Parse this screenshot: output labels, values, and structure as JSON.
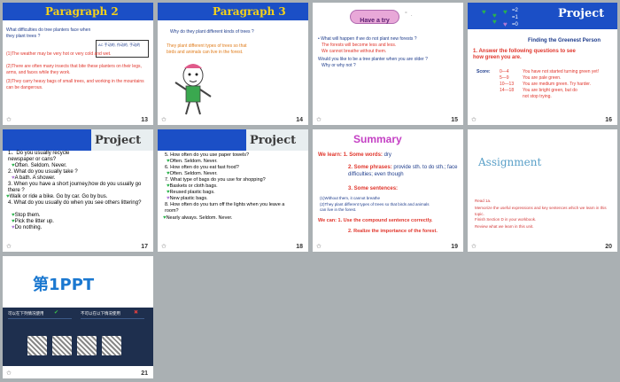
{
  "slides": [
    {
      "num": "13",
      "title": "Paragraph 2",
      "q": "What difficulties  do tree planters face when they plant trees ?",
      "note": "AC 手动的, 作动的, 手动的",
      "a": [
        "(1)The weather may be very hot or very cold and wet.",
        "(2)There are often many insects that bite these planters on their legs, arms, and faces while they work.",
        "(3)They carry heavy bags of small trees, and working in the mountains can be dangerous."
      ]
    },
    {
      "num": "14",
      "title": "Paragraph 3",
      "q": "Why do they plant different kinds of trees ?",
      "a": "They plant different types of trees so that birds and animals can live in the forest."
    },
    {
      "num": "15",
      "badge": "Have a try",
      "lines": [
        "What will happen if we do not plant new forests ?",
        "The forests will become less and less.",
        "We cannot breathe without them.",
        "Would you like to be a tree planter when you are older ?",
        "Why or why not ?"
      ]
    },
    {
      "num": "16",
      "title": "Project",
      "hearts": [
        "=2",
        "=1",
        "=0"
      ],
      "sub": "Finding the Greenest Person",
      "task": "1. Answer the following questions to see how green you are.",
      "score_label": "Score:",
      "scores": [
        [
          "0—4",
          "You have not started turning green yet!"
        ],
        [
          "5—9",
          "You are pale green."
        ],
        [
          "10—13",
          "You are medium green. Try harder."
        ],
        [
          "14—18",
          "You are bright green, but do not stop trying."
        ]
      ]
    },
    {
      "num": "17",
      "title": "Project",
      "lines": [
        "1、Do you usually recycle newspaper or cans?",
        "Often.    Seldom.    Never.",
        "2. What do you usually take ?",
        "A bath.         A shower.",
        "3. When you have a short journey,how do you usually go there ?",
        "Walk or ride a bike.   Go by car.   Go by bus.",
        "4. What do you usually do when you see others littering?",
        "Stop them.",
        "Pick the litter up.",
        "Do nothing."
      ]
    },
    {
      "num": "18",
      "title": "Project",
      "lines": [
        "5. How often do you use paper towels?",
        "Often.     Seldom.     Never.",
        "6. How often do you eat fast food?",
        "Often.     Seldom.     Never.",
        "7. What type of bags do you use for shopping?",
        "Baskets or cloth bags.",
        "Reused plastic bags.",
        "New plastic bags.",
        "8. How often do you turn off the lights when you leave a room?",
        "Nearly always.     Seldom.     Never."
      ]
    },
    {
      "num": "19",
      "title": "Summary",
      "l1": "We learn: 1. Some words:",
      "l1b": "dry",
      "l2": "2. Some phrases:",
      "l2b": "provide sth. to do sth.; face difficulties; even though",
      "l3": "3. Some sentences:",
      "s1": "(1)Without them, it cannot breathe",
      "s2": "(2)They plant different types of trees so that birds and animals can live in the forest.",
      "c1": "We can: 1. Use the compound sentence correctly.",
      "c2": "2. Realize the importance of the forest."
    },
    {
      "num": "20",
      "title": "Assignment",
      "items": [
        "Read 1a.",
        "Memorize the useful expressions  and key sentences which we learn in this  topic.",
        "Finish Section D in your workbook.",
        "Review what we learn in this  unit."
      ]
    },
    {
      "num": "21",
      "logo_num": "第1",
      "logo_txt": "PPT",
      "left_head": "可以在下列情况使用",
      "right_head": "不可以在以下情况使用"
    }
  ]
}
